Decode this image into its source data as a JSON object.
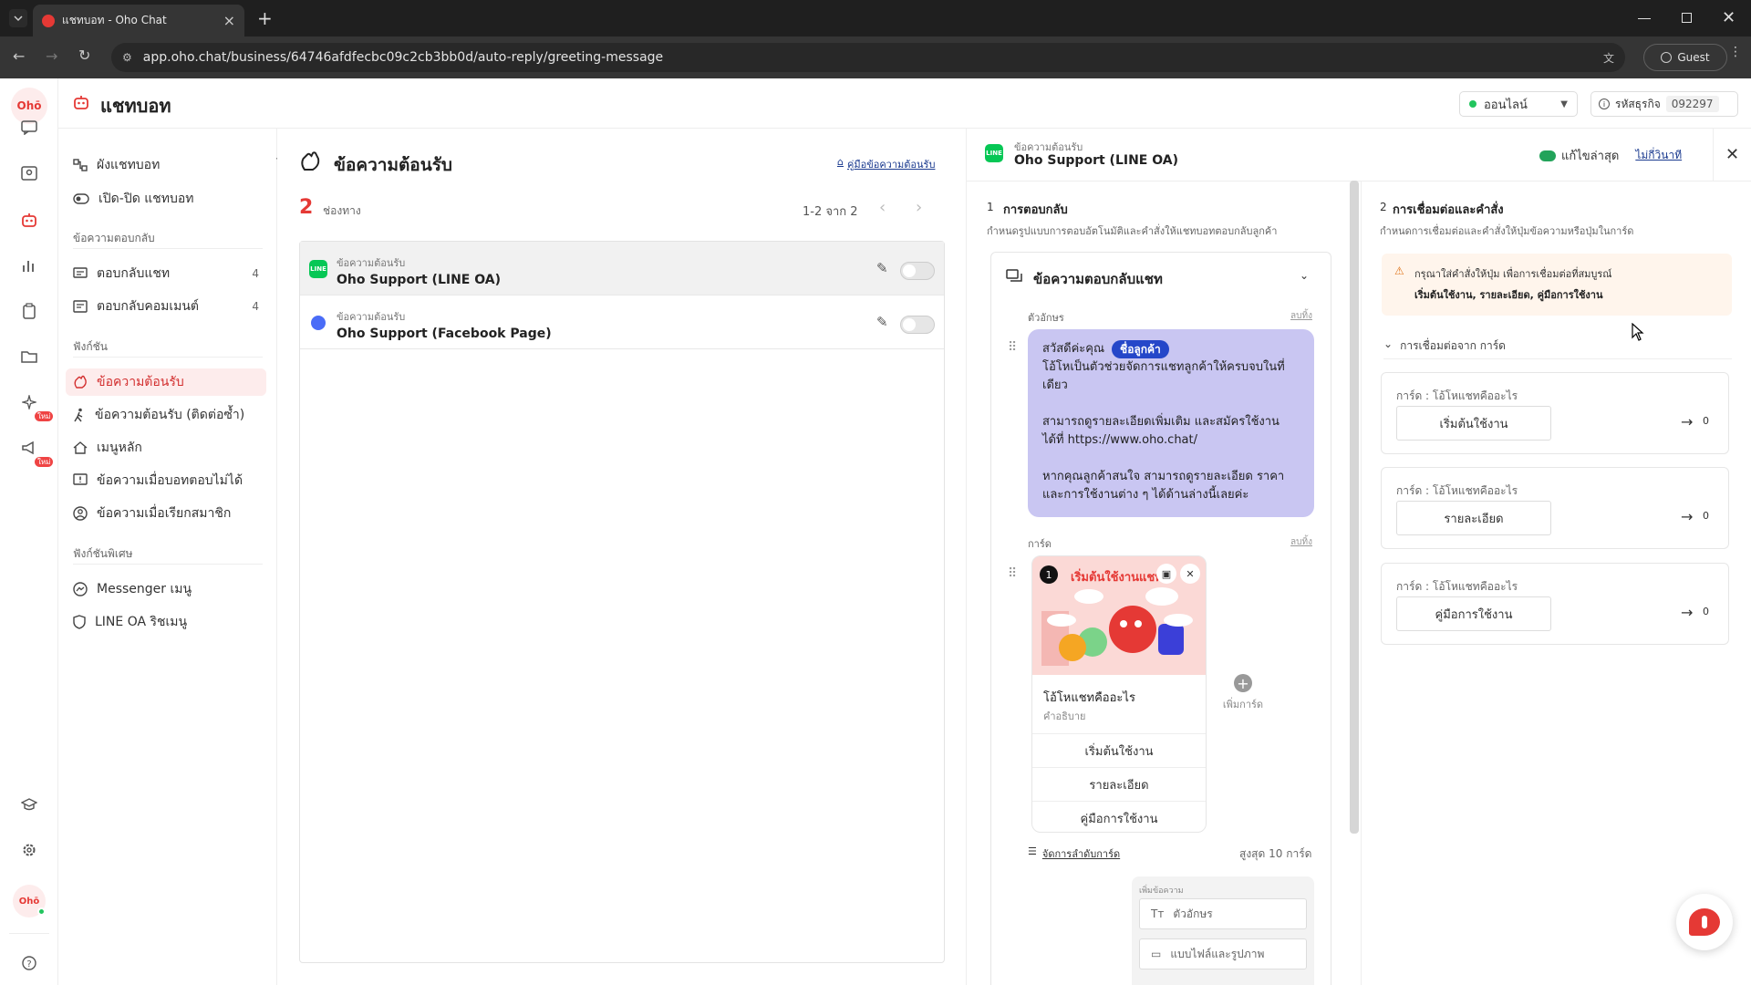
{
  "browser": {
    "tab_title": "แชทบอท - Oho Chat",
    "url": "app.oho.chat/business/64746afdfecbc09c2cb3bb0d/auto-reply/greeting-message",
    "guest_label": "Guest",
    "new_tab": "+",
    "tab_close": "×"
  },
  "header": {
    "title": "แชทบอท",
    "status": "ออนไลน์",
    "business_id_label": "รหัสธุรกิจ",
    "business_id": "092297"
  },
  "rail": {
    "logo": "Ohō",
    "new_badge_1": "ใหม่",
    "new_badge_2": "ใหม่"
  },
  "nav": {
    "top_items": [
      {
        "label": "ผังแชทบอท"
      },
      {
        "label": "เปิด-ปิด แชทบอท"
      }
    ],
    "section_reply": "ข้อความตอบกลับ",
    "reply_items": [
      {
        "label": "ตอบกลับแชท",
        "count": "4"
      },
      {
        "label": "ตอบกลับคอมเมนต์",
        "count": "4"
      }
    ],
    "section_features": "ฟังก์ชัน",
    "feature_items": [
      {
        "label": "ข้อความต้อนรับ"
      },
      {
        "label": "ข้อความต้อนรับ (ติดต่อซ้ำ)"
      },
      {
        "label": "เมนูหลัก"
      },
      {
        "label": "ข้อความเมื่อบอทตอบไม่ได้"
      },
      {
        "label": "ข้อความเมื่อเรียกสมาชิก"
      }
    ],
    "section_special": "ฟังก์ชันพิเศษ",
    "special_items": [
      {
        "label": "Messenger เมนู"
      },
      {
        "label": "LINE OA ริชเมนู"
      }
    ]
  },
  "list": {
    "title": "ข้อความต้อนรับ",
    "guide_link": "คู่มือข้อความต้อนรับ",
    "channel_count": "2",
    "channel_label": "ช่องทาง",
    "pagination": "1-2 จาก 2",
    "rows": [
      {
        "sub": "ข้อความต้อนรับ",
        "name": "Oho Support (LINE OA)"
      },
      {
        "sub": "ข้อความต้อนรับ",
        "name": "Oho Support (Facebook Page)"
      }
    ]
  },
  "editor": {
    "sub": "ข้อความต้อนรับ",
    "name": "Oho Support (LINE OA)",
    "saved_label": "แก้ไขล่าสุด",
    "saved_time": "ไม่กี่วินาที",
    "section1_num": "1",
    "section1_title": "การตอบกลับ",
    "section1_desc": "กำหนดรูปแบบการตอบอัตโนมัติและคำสั่งให้แชทบอทตอบกลับลูกค้า",
    "chat_block_title": "ข้อความตอบกลับแชท",
    "text_label": "ตัวอักษร",
    "delete_label": "ลบทิ้ง",
    "msg_greet": "สวัสดีค่ะคุณ",
    "msg_chip": "ชื่อลูกค้า",
    "msg_line1": "โอ้โหเป็นตัวช่วยจัดการแชทลูกค้าให้ครบจบในที่เดียว",
    "msg_line2": "สามารถดูรายละเอียดเพิ่มเติม และสมัครใช้งานได้ที่ https://www.oho.chat/",
    "msg_line3": "หากคุณลูกค้าสนใจ สามารถดูรายละเอียด ราคา และการใช้งานต่าง ๆ ได้ด้านล่างนี้เลยค่ะ",
    "card_label": "การ์ด",
    "card_index": "1",
    "card_banner_title": "เริ่มต้นใช้งานแชท",
    "card_title": "โอ้โหแชทคืออะไร",
    "card_desc": "คำอธิบาย",
    "card_buttons": [
      {
        "label": "เริ่มต้นใช้งาน"
      },
      {
        "label": "รายละเอียด"
      },
      {
        "label": "คู่มือการใช้งาน"
      }
    ],
    "add_card": "เพิ่มการ์ด",
    "manage_cards": "จัดการลำดับการ์ด",
    "max_cards": "สูงสุด 10 การ์ด",
    "add_msg_label": "เพิ่มข้อความ",
    "add_text": "ตัวอักษร",
    "add_file": "แบบไฟล์และรูปภาพ",
    "section2_num": "2",
    "section2_title": "การเชื่อมต่อและคำสั่ง",
    "section2_desc": "กำหนดการเชื่อมต่อและคำสั่งให้ปุ่มข้อความหรือปุ่มในการ์ด",
    "warning_line1": "กรุณาใส่คำสั่งให้ปุ่ม เพื่อการเชื่อมต่อที่สมบูรณ์",
    "warning_line2": "เริ่มต้นใช้งาน, รายละเอียด, คู่มือการใช้งาน",
    "connect_from_card": "การเชื่อมต่อจาก การ์ด",
    "link_items": [
      {
        "card_label": "การ์ด : โอ้โหแชทคืออะไร",
        "button": "เริ่มต้นใช้งาน",
        "count": "0"
      },
      {
        "card_label": "การ์ด : โอ้โหแชทคืออะไร",
        "button": "รายละเอียด",
        "count": "0"
      },
      {
        "card_label": "การ์ด : โอ้โหแชทคืออะไร",
        "button": "คู่มือการใช้งาน",
        "count": "0"
      }
    ]
  },
  "colors": {
    "brand_red": "#e53935",
    "active_bg": "#fdecec",
    "bubble": "#c9c6f2",
    "chip": "#2547c9",
    "line_green": "#06c755",
    "messenger_blue": "#4a6cf7",
    "online_green": "#22c55e"
  }
}
